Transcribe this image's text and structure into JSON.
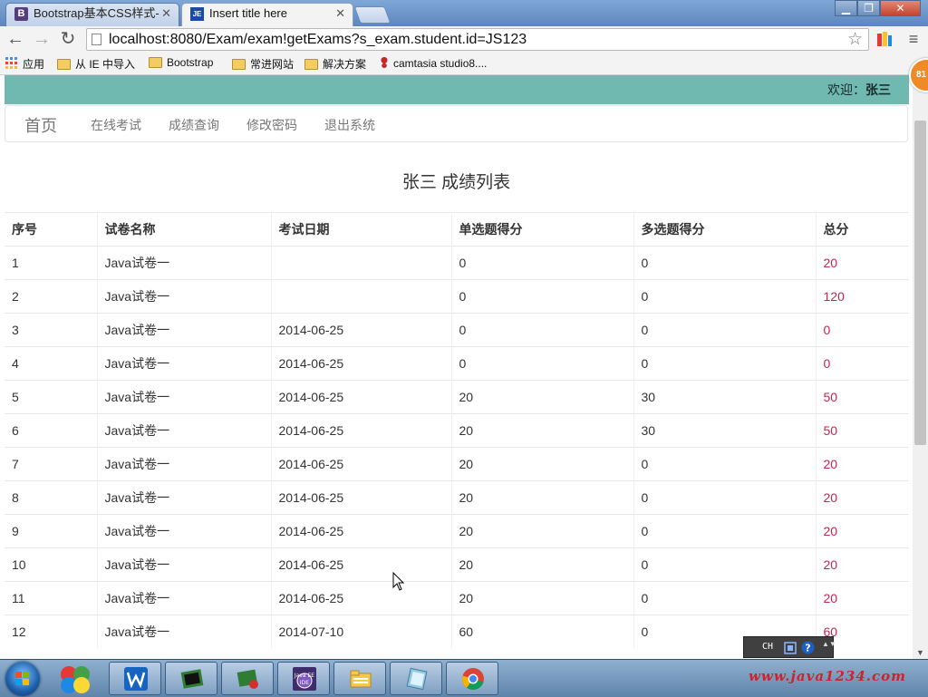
{
  "browser": {
    "tabs": [
      {
        "label": "Bootstrap基本CSS样式-",
        "favicon": "B",
        "active": false
      },
      {
        "label": "Insert title here",
        "favicon": "JE",
        "active": true
      }
    ],
    "url": "localhost:8080/Exam/exam!getExams?s_exam.student.id=JS123",
    "bookmarks": [
      {
        "label": "应用",
        "icon": "apps-grid-icon"
      },
      {
        "label": "从 IE 中导入",
        "icon": "folder-icon"
      },
      {
        "label": "Bootstrap",
        "icon": "folder-icon"
      },
      {
        "label": "常进网站",
        "icon": "folder-icon"
      },
      {
        "label": "解决方案",
        "icon": "folder-icon"
      },
      {
        "label": "camtasia studio8....",
        "icon": "camtasia-icon"
      }
    ]
  },
  "header": {
    "welcome_prefix": "欢迎：",
    "user_name": "张三"
  },
  "nav": {
    "brand": "首页",
    "items": [
      "在线考试",
      "成绩查询",
      "修改密码",
      "退出系统"
    ]
  },
  "main": {
    "title": "张三 成绩列表",
    "columns": [
      "序号",
      "试卷名称",
      "考试日期",
      "单选题得分",
      "多选题得分",
      "总分"
    ],
    "rows": [
      [
        "1",
        "Java试卷一",
        "",
        "0",
        "0",
        "20"
      ],
      [
        "2",
        "Java试卷一",
        "",
        "0",
        "0",
        "120"
      ],
      [
        "3",
        "Java试卷一",
        "2014-06-25",
        "0",
        "0",
        "0"
      ],
      [
        "4",
        "Java试卷一",
        "2014-06-25",
        "0",
        "0",
        "0"
      ],
      [
        "5",
        "Java试卷一",
        "2014-06-25",
        "20",
        "30",
        "50"
      ],
      [
        "6",
        "Java试卷一",
        "2014-06-25",
        "20",
        "30",
        "50"
      ],
      [
        "7",
        "Java试卷一",
        "2014-06-25",
        "20",
        "0",
        "20"
      ],
      [
        "8",
        "Java试卷一",
        "2014-06-25",
        "20",
        "0",
        "20"
      ],
      [
        "9",
        "Java试卷一",
        "2014-06-25",
        "20",
        "0",
        "20"
      ],
      [
        "10",
        "Java试卷一",
        "2014-06-25",
        "20",
        "0",
        "20"
      ],
      [
        "11",
        "Java试卷一",
        "2014-06-25",
        "20",
        "0",
        "20"
      ],
      [
        "12",
        "Java试卷一",
        "2014-07-10",
        "60",
        "0",
        "60"
      ]
    ]
  },
  "overlay": {
    "badge": "81",
    "tray_lang": "CH",
    "watermark": "www.java1234.com"
  },
  "colors": {
    "banner": "#70b9b1",
    "total_score": "#c7254e"
  }
}
